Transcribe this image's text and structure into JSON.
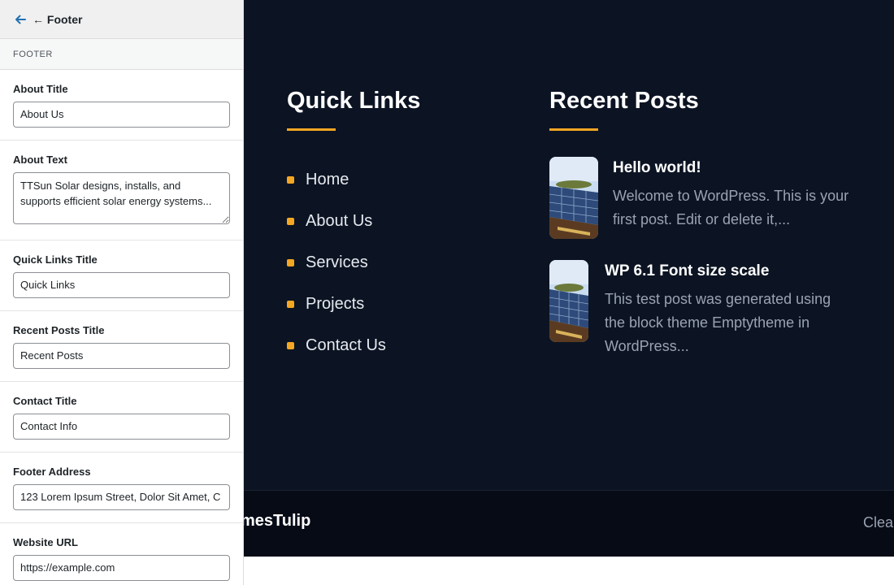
{
  "sidebar": {
    "header_title": "← Footer",
    "section_label": "FOOTER",
    "fields": [
      {
        "label": "About Title",
        "value": "About Us"
      },
      {
        "label": "About Text",
        "value": "TTSun Solar designs, installs, and supports efficient solar energy systems..."
      },
      {
        "label": "Quick Links Title",
        "value": "Quick Links"
      },
      {
        "label": "Recent Posts Title",
        "value": "Recent Posts"
      },
      {
        "label": "Contact Title",
        "value": "Contact Info"
      },
      {
        "label": "Footer Address",
        "value": "123 Lorem Ipsum Street, Dolor Sit Amet, C"
      },
      {
        "label": "Website URL",
        "value": "https://example.com"
      }
    ]
  },
  "preview": {
    "quick_links": {
      "title": "Quick Links",
      "items": [
        "Home",
        "About Us",
        "Services",
        "Projects",
        "Contact Us"
      ]
    },
    "recent_posts": {
      "title": "Recent Posts",
      "posts": [
        {
          "title": "Hello world!",
          "excerpt_lines": [
            "Welcome to WordPress. This is your",
            "first post. Edit or delete it,..."
          ]
        },
        {
          "title": "WP 6.1 Font size scale",
          "excerpt_lines": [
            "This test post was generated using",
            "the block theme Emptytheme in",
            "WordPress..."
          ]
        }
      ]
    },
    "bottom_bar": {
      "brand": "mesTulip",
      "right_text": "Clea"
    }
  },
  "colors": {
    "accent": "#f5a623",
    "footer_bg": "#0c1423",
    "bottom_bar_bg": "#060b16",
    "back_arrow": "#2271b1"
  }
}
